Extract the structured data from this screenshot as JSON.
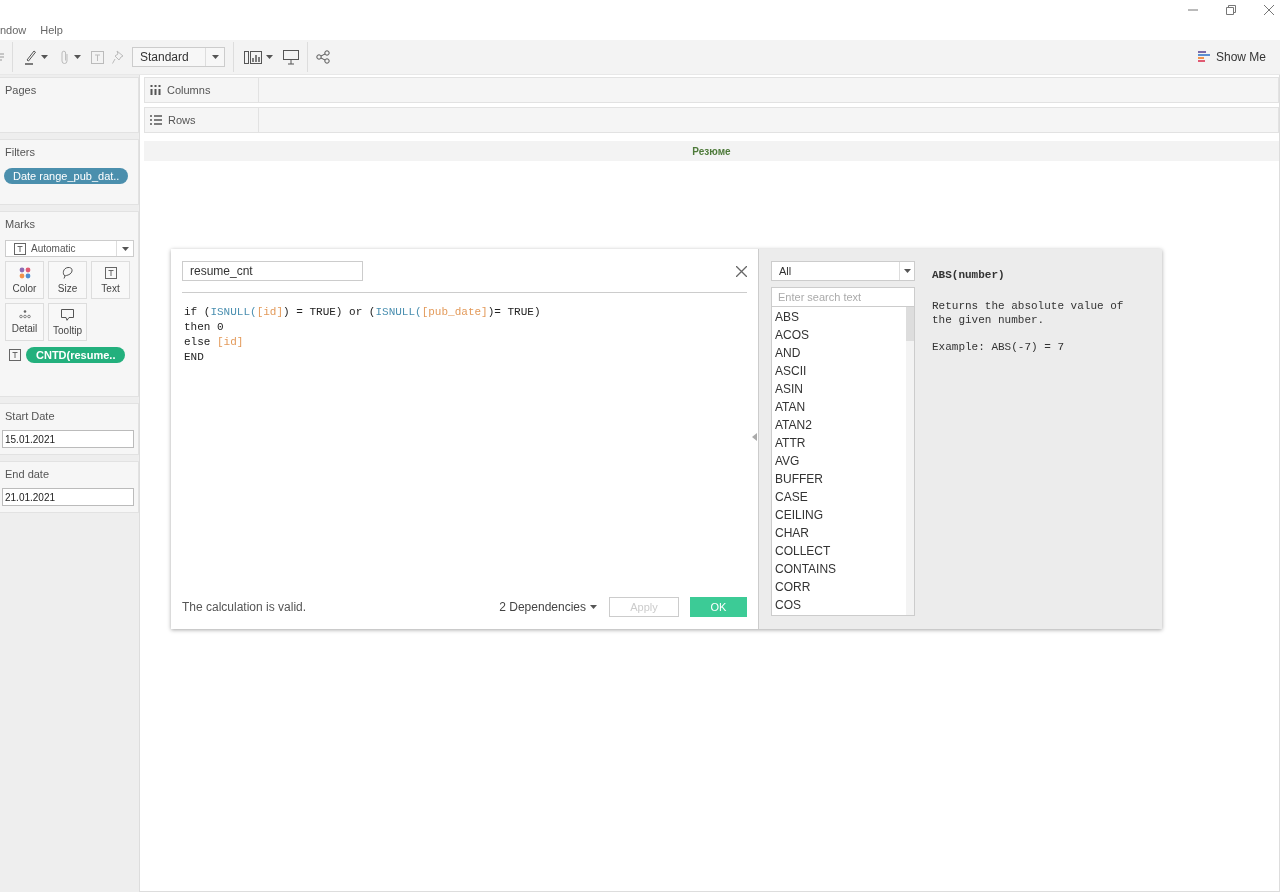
{
  "menu": [
    {
      "label": "ndow"
    },
    {
      "label": "Help"
    }
  ],
  "toolbar": {
    "view_size": "Standard",
    "show_me": "Show Me"
  },
  "sidebar": {
    "pages": {
      "title": "Pages"
    },
    "filters": {
      "title": "Filters",
      "pills": [
        "Date range_pub_dat.."
      ]
    },
    "marks": {
      "title": "Marks",
      "mark_type": "Automatic",
      "cards": [
        {
          "label": "Color",
          "kind": "color"
        },
        {
          "label": "Size",
          "kind": "size"
        },
        {
          "label": "Text",
          "kind": "text"
        },
        {
          "label": "Detail",
          "kind": "detail"
        },
        {
          "label": "Tooltip",
          "kind": "tooltip"
        }
      ],
      "fields": [
        {
          "label": "CNTD(resume..",
          "kind": "text"
        }
      ]
    },
    "parameters": [
      {
        "title": "Start Date",
        "value": "15.01.2021"
      },
      {
        "title": "End date",
        "value": "21.01.2021"
      }
    ]
  },
  "shelves": [
    {
      "label": "Columns",
      "kind": "columns"
    },
    {
      "label": "Rows",
      "kind": "rows"
    }
  ],
  "view": {
    "header": "Резюме"
  },
  "calc_dialog": {
    "name": "resume_cnt",
    "code": [
      [
        {
          "text": "if (",
          "kind": "plain"
        },
        {
          "text": "ISNULL(",
          "kind": "func"
        },
        {
          "text": "[id]",
          "kind": "field"
        },
        {
          "text": ") = TRUE) or (",
          "kind": "plain"
        },
        {
          "text": "ISNULL(",
          "kind": "func"
        },
        {
          "text": "[pub_date]",
          "kind": "field"
        },
        {
          "text": ")= TRUE)",
          "kind": "plain"
        }
      ],
      [
        {
          "text": "then 0",
          "kind": "plain"
        }
      ],
      [
        {
          "text": "else ",
          "kind": "plain"
        },
        {
          "text": "[id]",
          "kind": "field"
        }
      ],
      [
        {
          "text": "END",
          "kind": "plain"
        }
      ]
    ],
    "status": "The calculation is valid.",
    "dependencies": "2 Dependencies",
    "buttons": [
      {
        "label": "Apply",
        "kind": "secondary",
        "disabled": true
      },
      {
        "label": "OK",
        "kind": "primary",
        "disabled": false
      }
    ],
    "category": "All",
    "search": {
      "placeholder": "Enter search text"
    },
    "functions": [
      "ABS",
      "ACOS",
      "AND",
      "ASCII",
      "ASIN",
      "ATAN",
      "ATAN2",
      "ATTR",
      "AVG",
      "BUFFER",
      "CASE",
      "CEILING",
      "CHAR",
      "COLLECT",
      "CONTAINS",
      "CORR",
      "COS"
    ],
    "help": {
      "signature": "ABS(number)",
      "description": "Returns the absolute value of the given number.",
      "example": "Example: ABS(-7) = 7"
    }
  }
}
